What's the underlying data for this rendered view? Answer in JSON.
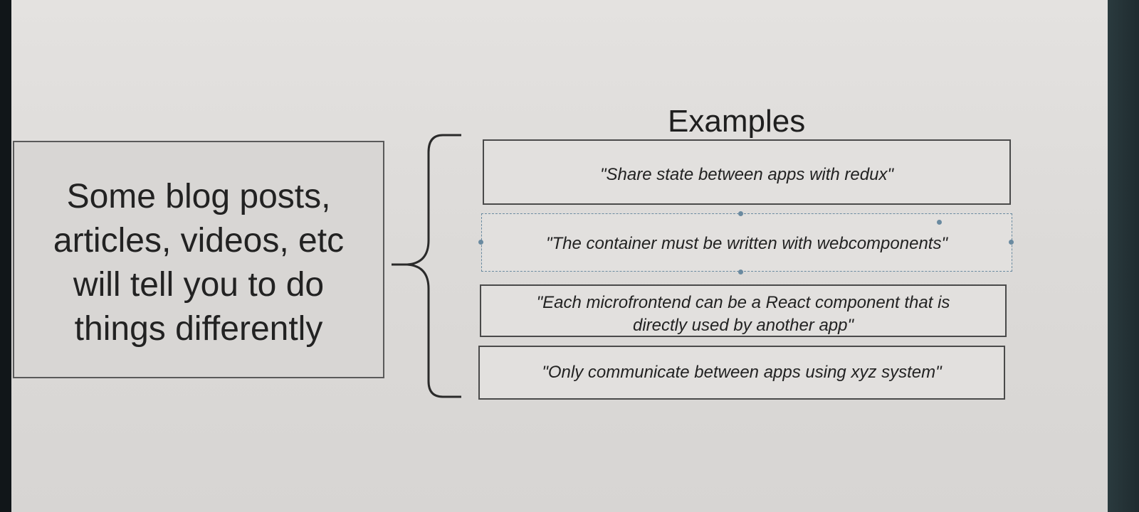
{
  "slide": {
    "title": "Examples",
    "main_text_lines": [
      "Some blog posts,",
      "articles, videos, etc",
      "will tell you to do",
      "things differently"
    ],
    "examples": [
      {
        "lines": [
          "\"Share state between apps with redux\""
        ]
      },
      {
        "lines": [
          "\"The container must be written with webcomponents\""
        ]
      },
      {
        "lines": [
          "\"Each microfrontend can be a React component that is",
          "directly used by another app\""
        ]
      },
      {
        "lines": [
          "\"Only communicate between apps using xyz system\""
        ]
      }
    ]
  },
  "colors": {
    "slide_background": "#dcdad8",
    "box_border": "#4a4a4a",
    "selection_handle": "#6a8aa0"
  }
}
